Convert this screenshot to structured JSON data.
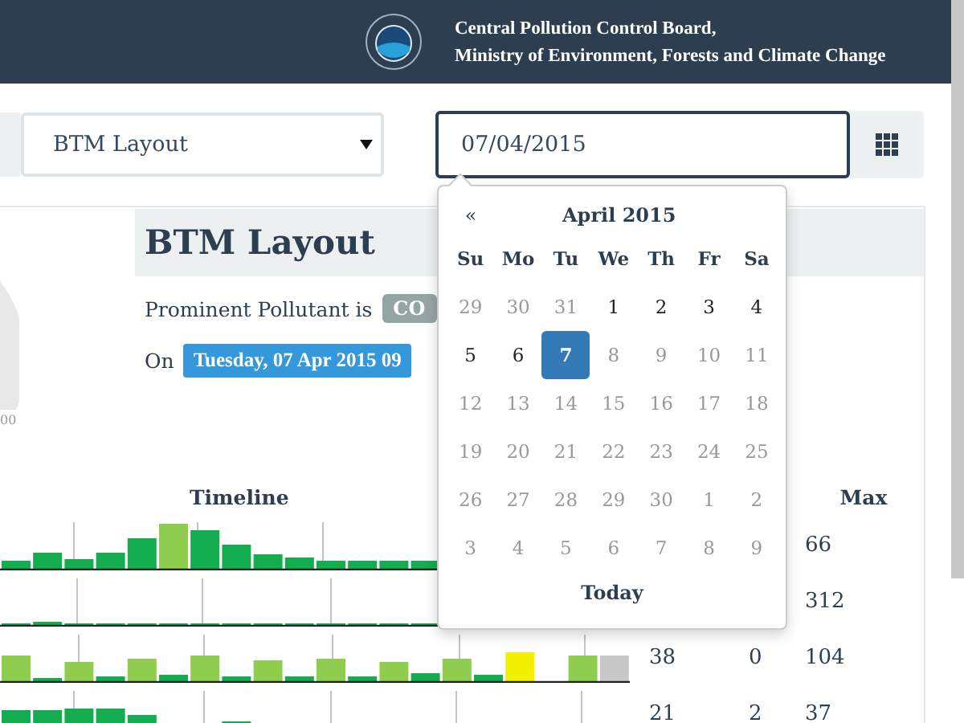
{
  "header": {
    "line_1": "Central Pollution Control Board,",
    "line_2": "Ministry of Environment, Forests and Climate Change"
  },
  "station_select": {
    "value": "BTM Layout"
  },
  "date_field": {
    "value": "07/04/2015"
  },
  "panel": {
    "title": "BTM Layout",
    "pollutant_label": "Prominent Pollutant is",
    "pollutant": "CO",
    "on_label": "On",
    "timestamp": "Tuesday, 07 Apr 2015 09"
  },
  "gauge": {
    "tick_label": "00"
  },
  "table": {
    "timeline_heading": "Timeline",
    "max_heading": "Max",
    "rows": [
      {
        "column_2": "",
        "column_3": "",
        "max": "66"
      },
      {
        "column_2": "",
        "column_3": "",
        "max": "312"
      },
      {
        "column_2": "38",
        "column_3": "0",
        "max": "104"
      },
      {
        "column_2": "21",
        "column_3": "2",
        "max": "37"
      }
    ]
  },
  "calendar": {
    "prev": "«",
    "month": "April 2015",
    "weekdays": [
      "Su",
      "Mo",
      "Tu",
      "We",
      "Th",
      "Fr",
      "Sa"
    ],
    "weeks": [
      [
        {
          "day": "29",
          "disabled": true,
          "selected": false
        },
        {
          "day": "30",
          "disabled": true,
          "selected": false
        },
        {
          "day": "31",
          "disabled": true,
          "selected": false
        },
        {
          "day": "1",
          "disabled": false,
          "selected": false
        },
        {
          "day": "2",
          "disabled": false,
          "selected": false
        },
        {
          "day": "3",
          "disabled": false,
          "selected": false
        },
        {
          "day": "4",
          "disabled": false,
          "selected": false
        }
      ],
      [
        {
          "day": "5",
          "disabled": false,
          "selected": false
        },
        {
          "day": "6",
          "disabled": false,
          "selected": false
        },
        {
          "day": "7",
          "disabled": false,
          "selected": true
        },
        {
          "day": "8",
          "disabled": true,
          "selected": false
        },
        {
          "day": "9",
          "disabled": true,
          "selected": false
        },
        {
          "day": "10",
          "disabled": true,
          "selected": false
        },
        {
          "day": "11",
          "disabled": true,
          "selected": false
        }
      ],
      [
        {
          "day": "12",
          "disabled": true,
          "selected": false
        },
        {
          "day": "13",
          "disabled": true,
          "selected": false
        },
        {
          "day": "14",
          "disabled": true,
          "selected": false
        },
        {
          "day": "15",
          "disabled": true,
          "selected": false
        },
        {
          "day": "16",
          "disabled": true,
          "selected": false
        },
        {
          "day": "17",
          "disabled": true,
          "selected": false
        },
        {
          "day": "18",
          "disabled": true,
          "selected": false
        }
      ],
      [
        {
          "day": "19",
          "disabled": true,
          "selected": false
        },
        {
          "day": "20",
          "disabled": true,
          "selected": false
        },
        {
          "day": "21",
          "disabled": true,
          "selected": false
        },
        {
          "day": "22",
          "disabled": true,
          "selected": false
        },
        {
          "day": "23",
          "disabled": true,
          "selected": false
        },
        {
          "day": "24",
          "disabled": true,
          "selected": false
        },
        {
          "day": "25",
          "disabled": true,
          "selected": false
        }
      ],
      [
        {
          "day": "26",
          "disabled": true,
          "selected": false
        },
        {
          "day": "27",
          "disabled": true,
          "selected": false
        },
        {
          "day": "28",
          "disabled": true,
          "selected": false
        },
        {
          "day": "29",
          "disabled": true,
          "selected": false
        },
        {
          "day": "30",
          "disabled": true,
          "selected": false
        },
        {
          "day": "1",
          "disabled": true,
          "selected": false
        },
        {
          "day": "2",
          "disabled": true,
          "selected": false
        }
      ],
      [
        {
          "day": "3",
          "disabled": true,
          "selected": false
        },
        {
          "day": "4",
          "disabled": true,
          "selected": false
        },
        {
          "day": "5",
          "disabled": true,
          "selected": false
        },
        {
          "day": "6",
          "disabled": true,
          "selected": false
        },
        {
          "day": "7",
          "disabled": true,
          "selected": false
        },
        {
          "day": "8",
          "disabled": true,
          "selected": false
        },
        {
          "day": "9",
          "disabled": true,
          "selected": false
        }
      ]
    ],
    "today": "Today"
  }
}
